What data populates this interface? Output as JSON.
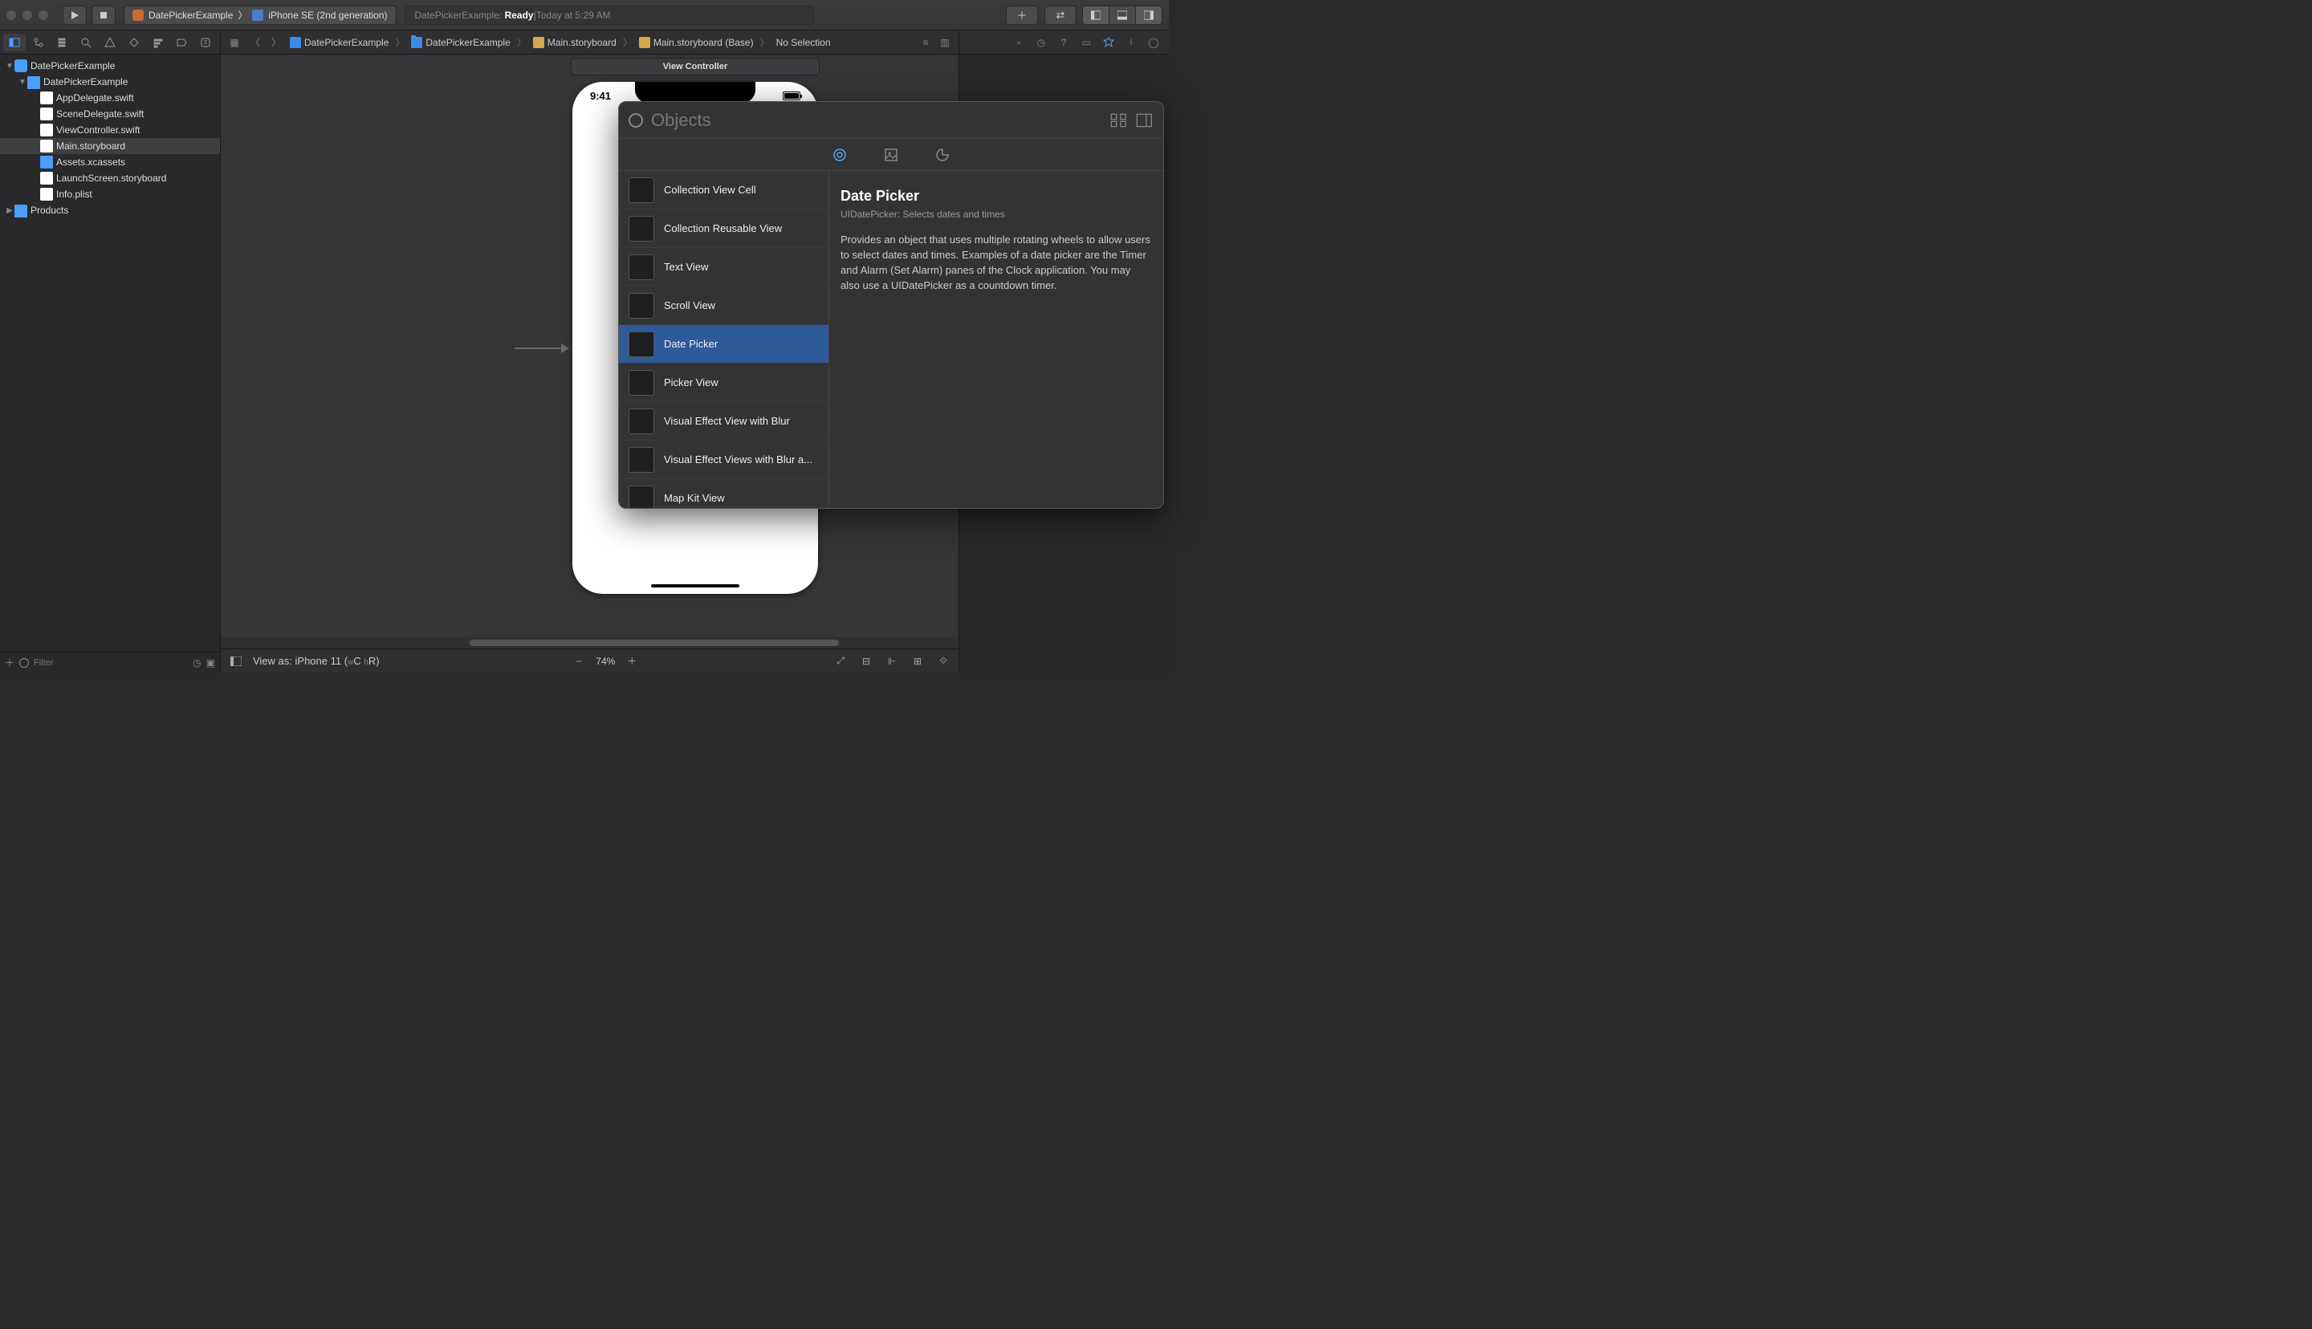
{
  "scheme": {
    "app_name": "DatePickerExample",
    "device": "iPhone SE (2nd generation)"
  },
  "status": {
    "project": "DatePickerExample:",
    "state": "Ready",
    "separator": " | ",
    "time": "Today at 5:29 AM"
  },
  "breadcrumbs": {
    "items": [
      {
        "label": "DatePickerExample",
        "icon": "proj"
      },
      {
        "label": "DatePickerExample",
        "icon": "fold"
      },
      {
        "label": "Main.storyboard",
        "icon": "sb"
      },
      {
        "label": "Main.storyboard (Base)",
        "icon": "sb"
      },
      {
        "label": "No Selection",
        "icon": ""
      }
    ]
  },
  "tree": [
    {
      "depth": 0,
      "disclosure": "▼",
      "icon": "app",
      "label": "DatePickerExample"
    },
    {
      "depth": 1,
      "disclosure": "▼",
      "icon": "folder",
      "label": "DatePickerExample"
    },
    {
      "depth": 2,
      "disclosure": "",
      "icon": "swift",
      "label": "AppDelegate.swift"
    },
    {
      "depth": 2,
      "disclosure": "",
      "icon": "swift",
      "label": "SceneDelegate.swift"
    },
    {
      "depth": 2,
      "disclosure": "",
      "icon": "swift",
      "label": "ViewController.swift"
    },
    {
      "depth": 2,
      "disclosure": "",
      "icon": "storyboard",
      "label": "Main.storyboard",
      "selected": true
    },
    {
      "depth": 2,
      "disclosure": "",
      "icon": "assets",
      "label": "Assets.xcassets"
    },
    {
      "depth": 2,
      "disclosure": "",
      "icon": "storyboard",
      "label": "LaunchScreen.storyboard"
    },
    {
      "depth": 2,
      "disclosure": "",
      "icon": "plist",
      "label": "Info.plist"
    },
    {
      "depth": 0,
      "disclosure": "▶",
      "icon": "folder",
      "label": "Products"
    }
  ],
  "filter_placeholder": "Filter",
  "canvas": {
    "scene_label": "View Controller",
    "clock": "9:41"
  },
  "footer": {
    "view_as_prefix": "View as: ",
    "view_as_device": "iPhone 11 (",
    "kbd1": "w",
    "kbd_c": "C ",
    "kbd2": "h",
    "kbd_r": "R)",
    "zoom": "74%"
  },
  "library": {
    "search_placeholder": "Objects",
    "items": [
      {
        "label": "Collection View Cell"
      },
      {
        "label": "Collection Reusable View"
      },
      {
        "label": "Text View"
      },
      {
        "label": "Scroll View"
      },
      {
        "label": "Date Picker",
        "selected": true
      },
      {
        "label": "Picker View"
      },
      {
        "label": "Visual Effect View with Blur"
      },
      {
        "label": "Visual Effect Views with Blur a..."
      },
      {
        "label": "Map Kit View"
      }
    ],
    "detail": {
      "title": "Date Picker",
      "subtitle": "UIDatePicker: Selects dates and times",
      "description": "Provides an object that uses multiple rotating wheels to allow users to select dates and times. Examples of a date picker are the Timer and Alarm (Set Alarm) panes of the Clock application. You may also use a UIDatePicker as a countdown timer."
    }
  }
}
